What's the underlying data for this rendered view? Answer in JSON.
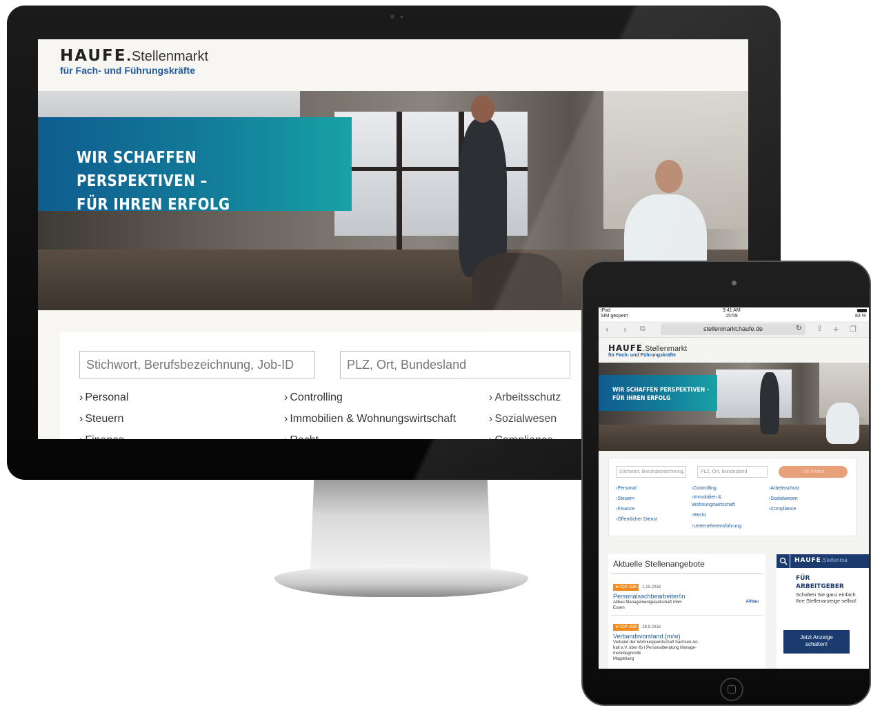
{
  "site": {
    "logo_mark": "HAUFE",
    "logo_dot": ".",
    "logo_text": "Stellenmarkt",
    "logo_sub": "für Fach- und Führungskräfte"
  },
  "hero": {
    "line1": "WIR SCHAFFEN PERSPEKTIVEN –",
    "line2": "FÜR IHREN ERFOLG"
  },
  "search": {
    "keyword_placeholder": "Stichwort, Berufsbezeichnung, Job-ID",
    "location_placeholder": "PLZ, Ort, Bundesland",
    "button_label": "Job finden"
  },
  "categories": {
    "col1": [
      "Personal",
      "Steuern",
      "Finance",
      "Öffentlicher Dienst"
    ],
    "col2": [
      "Controlling",
      "Immobilien & Wohnungswirtschaft",
      "Recht",
      "Unternehmensführung"
    ],
    "col3": [
      "Arbeitsschutz",
      "Sozialwesen",
      "Compliance"
    ]
  },
  "ipad": {
    "status": {
      "left_top": "iPad",
      "left_bottom": "SIM gesperrt",
      "time_top": "9:41 AM",
      "time_bottom": "15:59",
      "battery": "83 %"
    },
    "url": "stellenmarkt.haufe.de",
    "col2_extra": "Wohnungswirtschaft",
    "jobs": {
      "heading": "Aktuelle Stellenangebote",
      "items": [
        {
          "badge": "TOP-JOB",
          "date": "1.10.2018",
          "title": "Personalsachbearbeiter/in",
          "company": "Allbau Managementgesellschaft mbH",
          "location": "Essen",
          "logo": "Allbau"
        },
        {
          "badge": "TOP-JOB",
          "date": "28.9.2018",
          "title": "Verbandsvorstand (m/w)",
          "company": "Verband der Wohnungswirtschaft Sachsen-An-",
          "company2": "halt e.V. über ifp I Personalberatung Manage-",
          "company3": "mentdiagnostik",
          "location": "Magdeburg"
        }
      ]
    },
    "employer": {
      "logo": "HAUFE",
      "logo_ext": ".Stellenma",
      "title1": "FÜR",
      "title2": "ARBEITGEBER",
      "text": "Schalten Sie ganz einfach Ihre Stellenanzeige selbst!",
      "button_line1": "Jetzt Anzeige",
      "button_line2": "schalten!"
    }
  },
  "colors": {
    "brand_blue": "#1e5a9c",
    "hero_gradient_start": "#0f5c8e",
    "hero_gradient_end": "#17a2a6",
    "topjob_orange": "#f28c1f",
    "employer_navy": "#1b3b6f"
  }
}
